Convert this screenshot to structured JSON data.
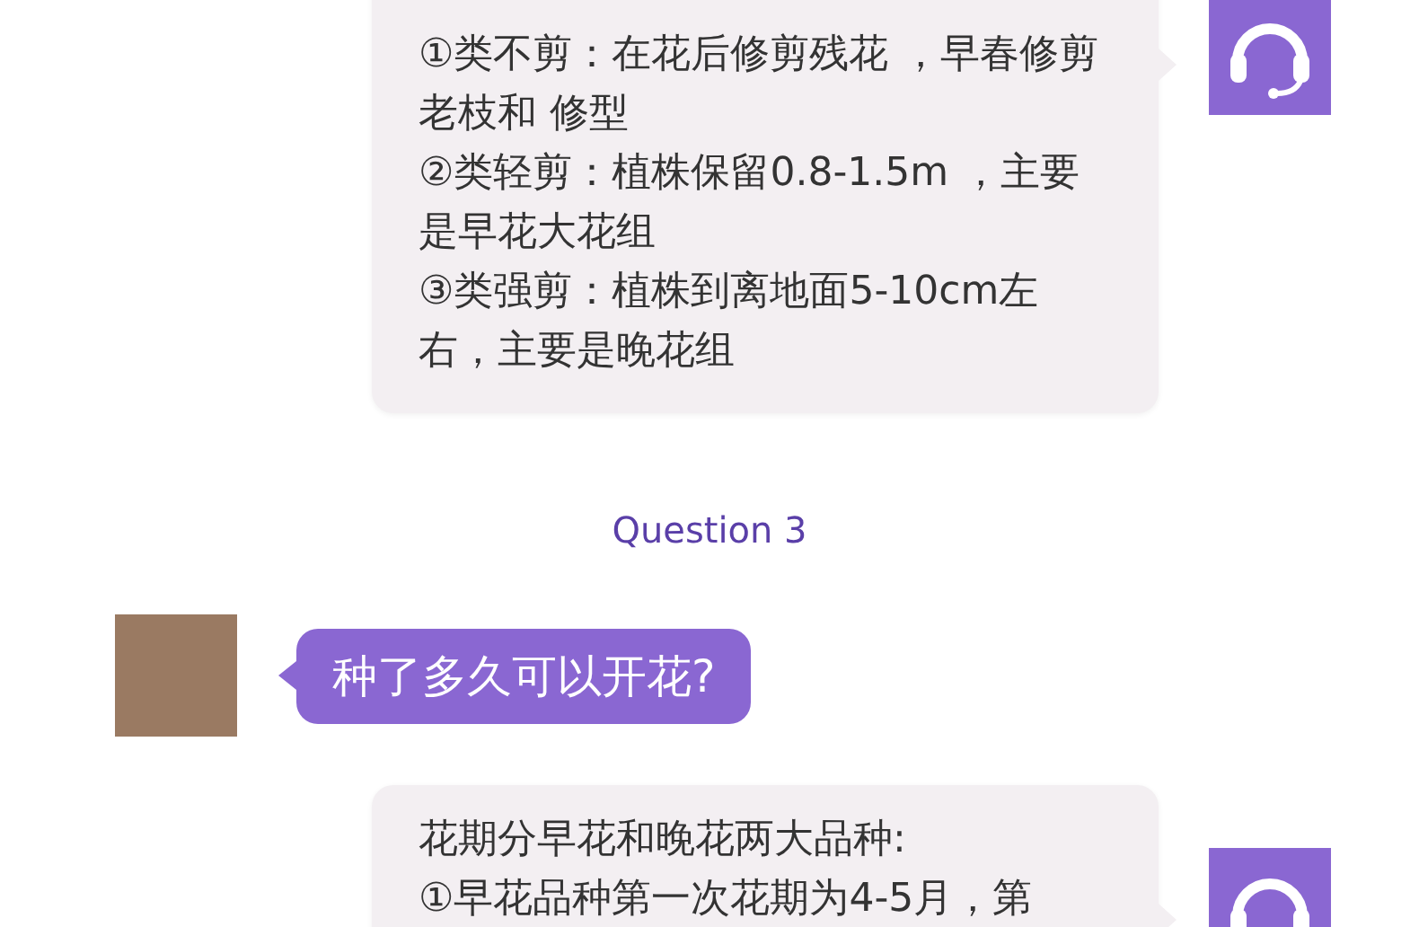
{
  "messages": [
    {
      "kind": "bot",
      "lines": [
        "①类不剪：在花后修剪残花 ，早春修剪老枝和 修型",
        "②类轻剪：植株保留0.8-1.5m ，主要是早花大花组",
        "③类强剪：植株到离地面5-10cm左右，主要是晚花组"
      ]
    },
    {
      "kind": "divider",
      "text": "Question 3"
    },
    {
      "kind": "user",
      "text": "种了多久可以开花?"
    },
    {
      "kind": "bot",
      "lines": [
        "花期分早花和晚花两大品种:",
        "①早花品种第一次花期为4-5月，第"
      ]
    }
  ]
}
